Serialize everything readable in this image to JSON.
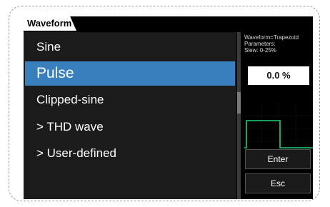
{
  "tab": {
    "title": "Waveform"
  },
  "list": {
    "items": [
      {
        "label": "Sine"
      },
      {
        "label": "Pulse"
      },
      {
        "label": "Clipped-sine"
      },
      {
        "label": "> THD wave"
      },
      {
        "label": "> User-defined"
      }
    ],
    "selected_index": 1
  },
  "panel": {
    "info_line1": "Waveform=Trapezoid",
    "info_line2": "Parameters:",
    "info_line3": "Slew:  0-25%",
    "value": "0.0 %",
    "enter_label": "Enter",
    "esc_label": "Esc"
  },
  "colors": {
    "selection": "#3a7fbd",
    "waveform": "#1fd27a"
  },
  "icons": [
    "pulse-waveform-preview"
  ]
}
